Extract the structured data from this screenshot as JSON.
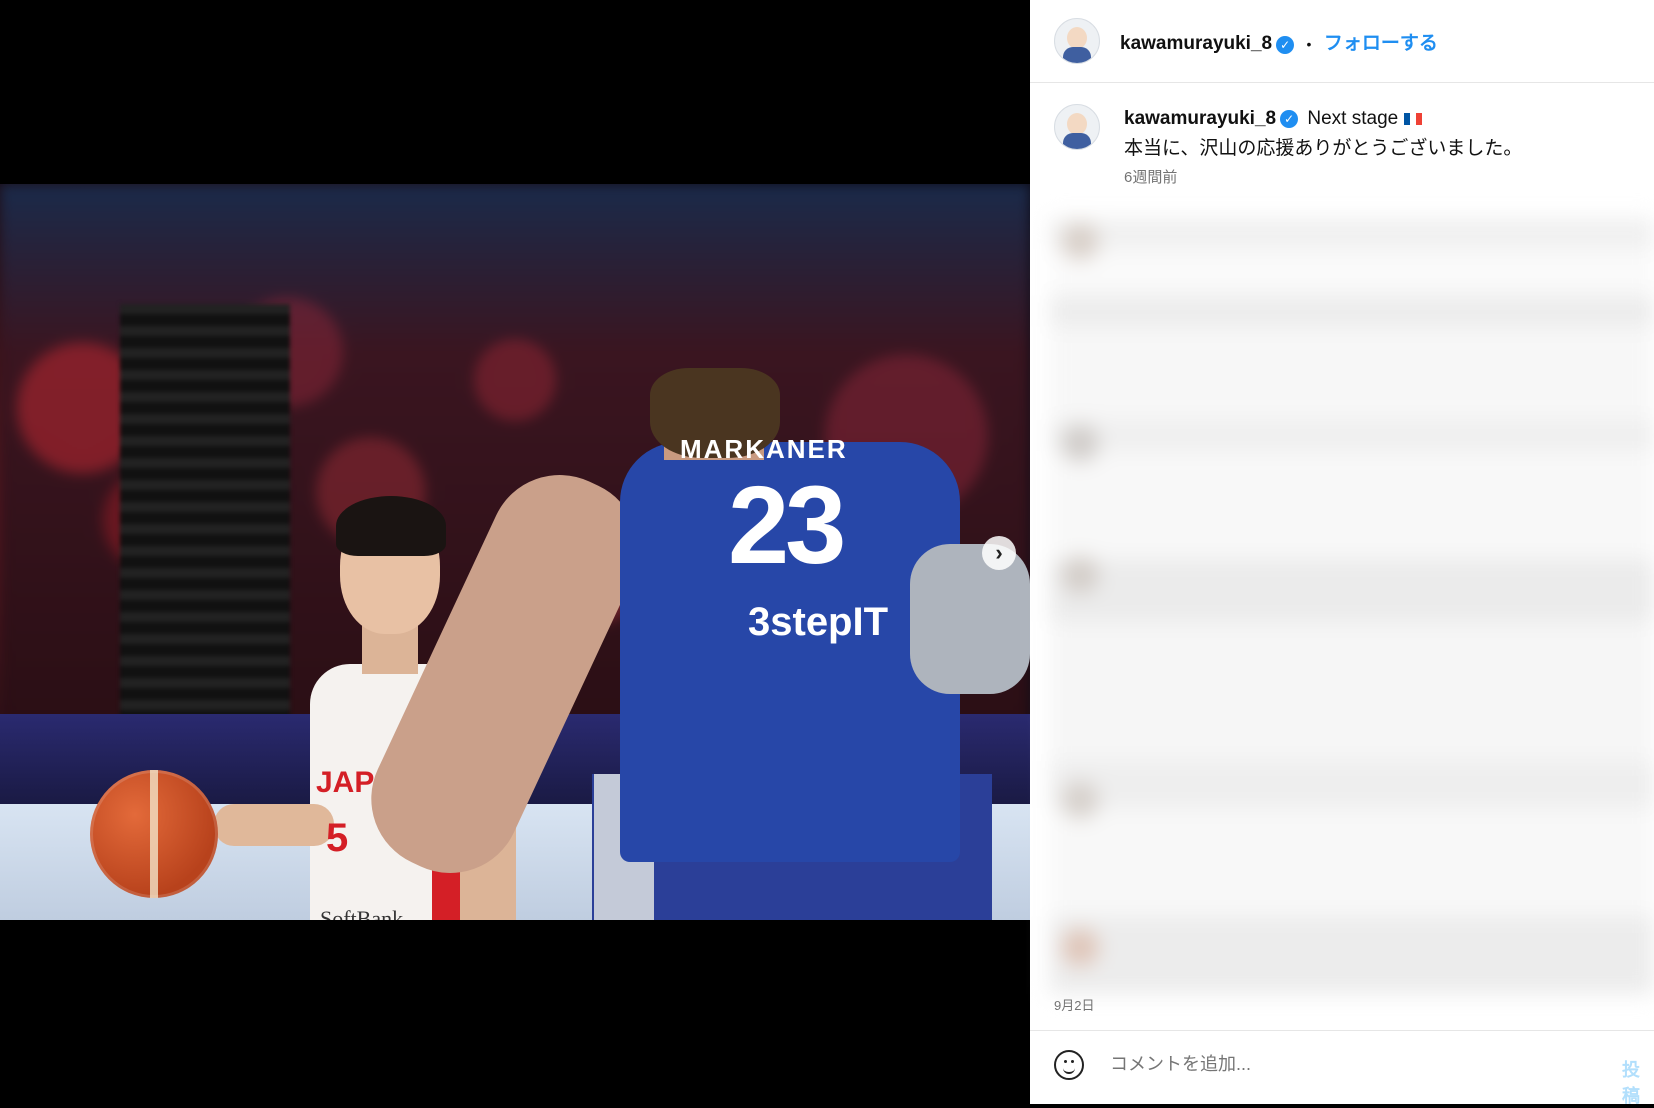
{
  "post": {
    "username": "kawamurayuki_8",
    "follow_label": "フォローする",
    "separator": "•",
    "caption_title": "Next stage",
    "caption_text": "本当に、沢山の応援ありがとうございました。",
    "time_ago": "6週間前",
    "date": "9月2日"
  },
  "photo": {
    "jersey_country": "JAPAN",
    "jersey_number_front": "5",
    "jersey_sponsor": "SoftBank",
    "opponent_name": "MARKANER",
    "opponent_number": "23",
    "opponent_sponsor": "3stepIT",
    "next_icon": "chevron-right-icon"
  },
  "comment": {
    "placeholder": "コメントを追加...",
    "post_label": "投稿"
  },
  "colors": {
    "accent": "#1f8ef1",
    "japan_red": "#d41f26",
    "opponent_blue": "#2747a8"
  }
}
